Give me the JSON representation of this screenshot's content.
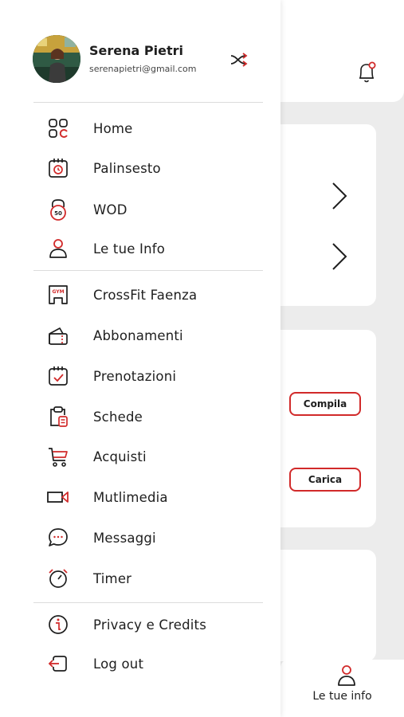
{
  "user": {
    "name": "Serena Pietri",
    "email": "serenapietri@gmail.com"
  },
  "colors": {
    "accent": "#d12a2a",
    "text": "#1e1e1e",
    "background": "#ececec"
  },
  "menu": {
    "section1": [
      {
        "label": "Home",
        "icon": "grid-icon"
      },
      {
        "label": "Palinsesto",
        "icon": "calendar-clock-icon"
      },
      {
        "label": "WOD",
        "icon": "kettlebell-icon"
      },
      {
        "label": "Le tue Info",
        "icon": "user-icon"
      }
    ],
    "section2": [
      {
        "label": "CrossFit Faenza",
        "icon": "gym-icon"
      },
      {
        "label": "Abbonamenti",
        "icon": "membership-icon"
      },
      {
        "label": "Prenotazioni",
        "icon": "calendar-check-icon"
      },
      {
        "label": "Schede",
        "icon": "clipboard-icon"
      },
      {
        "label": "Acquisti",
        "icon": "cart-icon"
      },
      {
        "label": "Mutlimedia",
        "icon": "video-icon"
      },
      {
        "label": "Messaggi",
        "icon": "chat-icon"
      },
      {
        "label": "Timer",
        "icon": "timer-icon"
      }
    ],
    "section3": [
      {
        "label": "Privacy e Credits",
        "icon": "info-icon"
      },
      {
        "label": "Log out",
        "icon": "logout-icon"
      }
    ]
  },
  "background": {
    "compila_label": "Compila",
    "carica_label": "Carica",
    "tab_label": "Le tue info",
    "kettlebell_number": "50"
  }
}
